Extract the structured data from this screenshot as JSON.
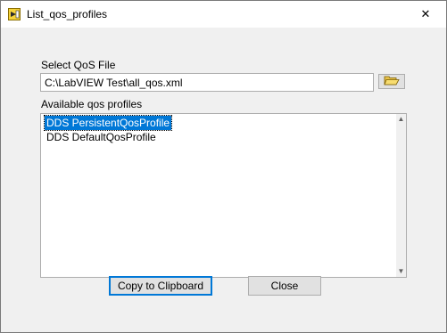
{
  "window": {
    "title": "List_qos_profiles",
    "close_glyph": "✕",
    "icon": "labview-vi-icon"
  },
  "file": {
    "label": "Select QoS File",
    "value": "C:\\LabVIEW Test\\all_qos.xml",
    "browse_icon": "folder-open-icon"
  },
  "profiles": {
    "label": "Available qos profiles",
    "items": [
      {
        "label": "DDS PersistentQosProfile",
        "selected": true
      },
      {
        "label": "DDS DefaultQosProfile",
        "selected": false
      }
    ]
  },
  "buttons": {
    "copy_label": "Copy to Clipboard",
    "close_label": "Close"
  },
  "colors": {
    "accent": "#0078d7",
    "selection": "#0078d7"
  }
}
